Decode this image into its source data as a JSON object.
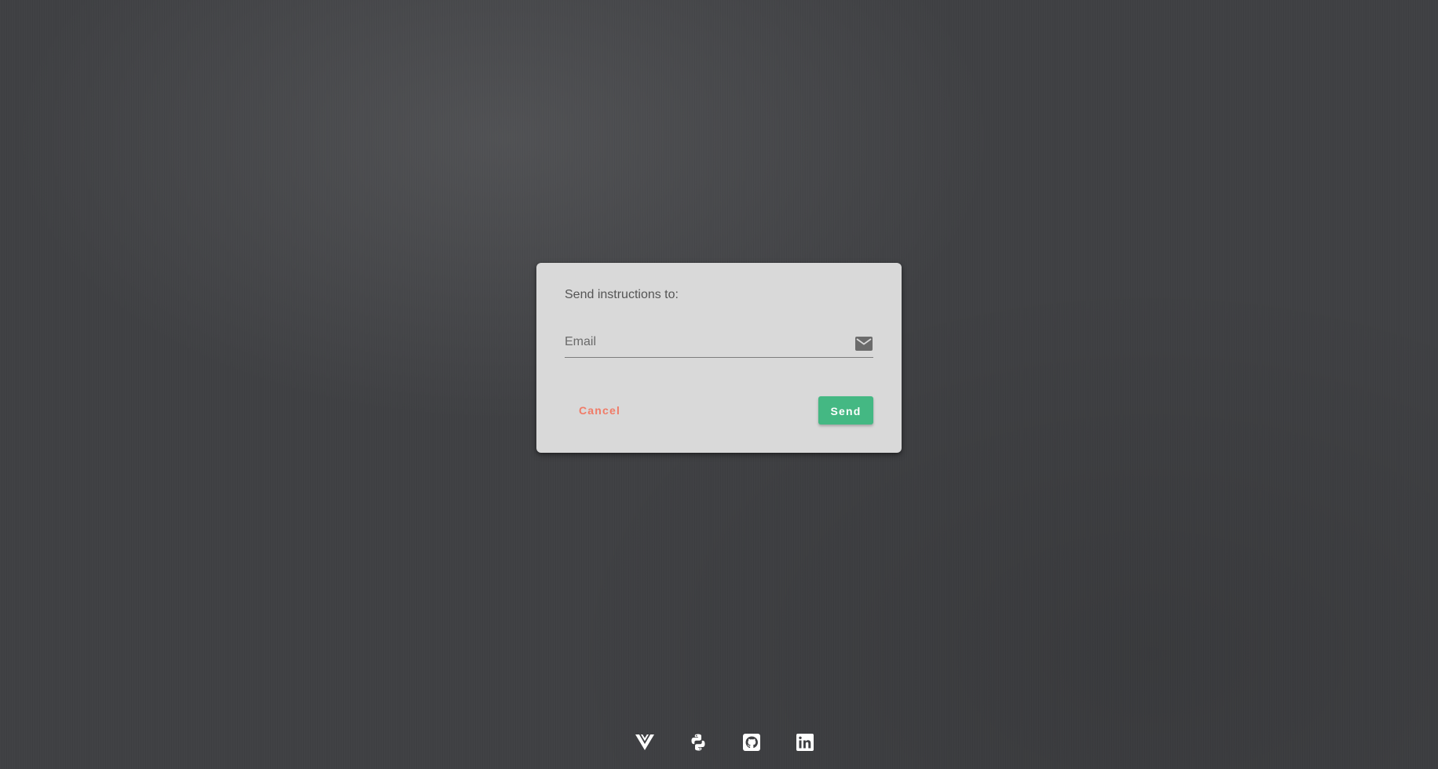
{
  "dialog": {
    "title": "Send instructions to:",
    "email_placeholder": "Email",
    "email_value": "",
    "email_icon": "mail-icon",
    "cancel_label": "Cancel",
    "send_label": "Send"
  },
  "footer": {
    "links": [
      {
        "icon": "vue-icon"
      },
      {
        "icon": "python-icon"
      },
      {
        "icon": "github-icon"
      },
      {
        "icon": "linkedin-icon"
      }
    ]
  },
  "colors": {
    "background": "#3f4043",
    "card": "#d9d9d9",
    "cancel": "#f07b67",
    "send": "#44b883"
  }
}
